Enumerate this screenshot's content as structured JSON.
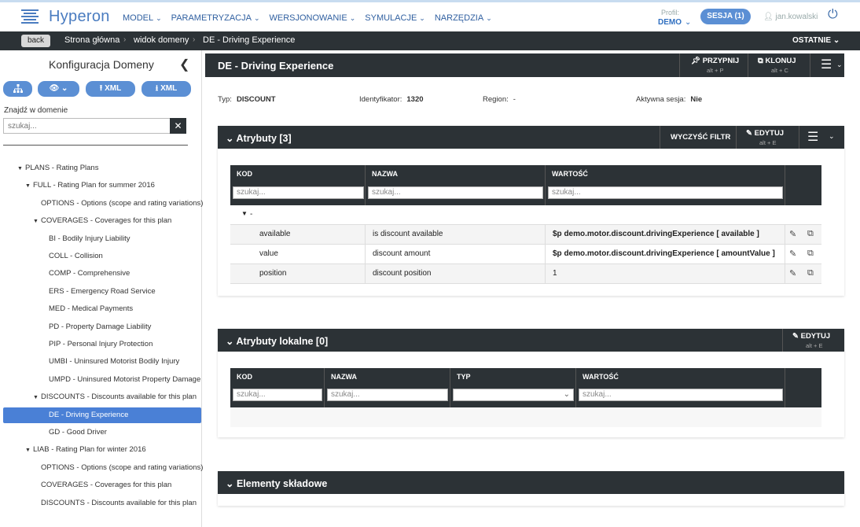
{
  "app": {
    "name": "Hyperon"
  },
  "menu": [
    {
      "label": "MODEL"
    },
    {
      "label": "PARAMETRYZACJA"
    },
    {
      "label": "WERSJONOWANIE"
    },
    {
      "label": "SYMULACJE"
    },
    {
      "label": "NARZĘDZIA"
    }
  ],
  "profile": {
    "label": "Profil:",
    "value": "DEMO"
  },
  "session": {
    "label": "SESJA (1)"
  },
  "user": {
    "name": "jan.kowalski"
  },
  "breadcrumb": {
    "back": "back",
    "items": [
      "Strona główna",
      "widok domeny",
      "DE - Driving Experience"
    ],
    "recent": "OSTATNIE"
  },
  "sidebar": {
    "title": "Konfiguracja Domeny",
    "xml_import": "XML",
    "xml_export": "XML",
    "find_label": "Znajdź w domenie",
    "search_placeholder": "szukaj...",
    "tree": [
      {
        "label": "PLANS - Rating Plans",
        "level": 0,
        "expanded": true
      },
      {
        "label": "FULL - Rating Plan for summer 2016",
        "level": 1,
        "expanded": true
      },
      {
        "label": "OPTIONS - Options (scope and rating variations)",
        "level": 2
      },
      {
        "label": "COVERAGES - Coverages for this plan",
        "level": 2,
        "expanded": true
      },
      {
        "label": "BI - Bodily Injury Liability",
        "level": 3
      },
      {
        "label": "COLL - Collision",
        "level": 3
      },
      {
        "label": "COMP - Comprehensive",
        "level": 3
      },
      {
        "label": "ERS - Emergency Road Service",
        "level": 3
      },
      {
        "label": "MED - Medical Payments",
        "level": 3
      },
      {
        "label": "PD - Property Damage Liability",
        "level": 3
      },
      {
        "label": "PIP - Personal Injury Protection",
        "level": 3
      },
      {
        "label": "UMBI - Uninsured Motorist Bodily Injury",
        "level": 3
      },
      {
        "label": "UMPD - Uninsured Motorist Property Damage",
        "level": 3
      },
      {
        "label": "DISCOUNTS - Discounts available for this plan",
        "level": 2,
        "expanded": true
      },
      {
        "label": "DE - Driving Experience",
        "level": 3,
        "selected": true
      },
      {
        "label": "GD - Good Driver",
        "level": 3
      },
      {
        "label": "LIAB - Rating Plan for winter 2016",
        "level": 1,
        "expanded": true
      },
      {
        "label": "OPTIONS - Options (scope and rating variations)",
        "level": 2
      },
      {
        "label": "COVERAGES - Coverages for this plan",
        "level": 2
      },
      {
        "label": "DISCOUNTS - Discounts available for this plan",
        "level": 2
      }
    ]
  },
  "main": {
    "title": "DE - Driving Experience",
    "pin": {
      "label": "PRZYPNIJ",
      "shortcut": "alt + P"
    },
    "clone": {
      "label": "KLONUJ",
      "shortcut": "alt + C"
    },
    "info": {
      "type_label": "Typ:",
      "type_value": "DISCOUNT",
      "id_label": "Identyfikator:",
      "id_value": "1320",
      "region_label": "Region:",
      "region_value": "-",
      "session_label": "Aktywna sesja:",
      "session_value": "Nie"
    }
  },
  "attributes": {
    "title": "Atrybuty [3]",
    "clear_filter": "WYCZYŚĆ FILTR",
    "edit": {
      "label": "EDYTUJ",
      "shortcut": "alt + E"
    },
    "columns": [
      "KOD",
      "NAZWA",
      "WARTOŚĆ"
    ],
    "filter_placeholder": "szukaj...",
    "group": "-",
    "rows": [
      {
        "kod": "available",
        "nazwa": "is discount available",
        "wartosc": "$p demo.motor.discount.drivingExperience [ available ]"
      },
      {
        "kod": "value",
        "nazwa": "discount amount",
        "wartosc": "$p demo.motor.discount.drivingExperience [ amountValue ]"
      },
      {
        "kod": "position",
        "nazwa": "discount position",
        "wartosc": "1"
      }
    ]
  },
  "local_attributes": {
    "title": "Atrybuty lokalne [0]",
    "edit": {
      "label": "EDYTUJ",
      "shortcut": "alt + E"
    },
    "columns": [
      "KOD",
      "NAZWA",
      "TYP",
      "WARTOŚĆ"
    ],
    "filter_placeholder": "szukaj..."
  },
  "components": {
    "title": "Elementy składowe"
  }
}
